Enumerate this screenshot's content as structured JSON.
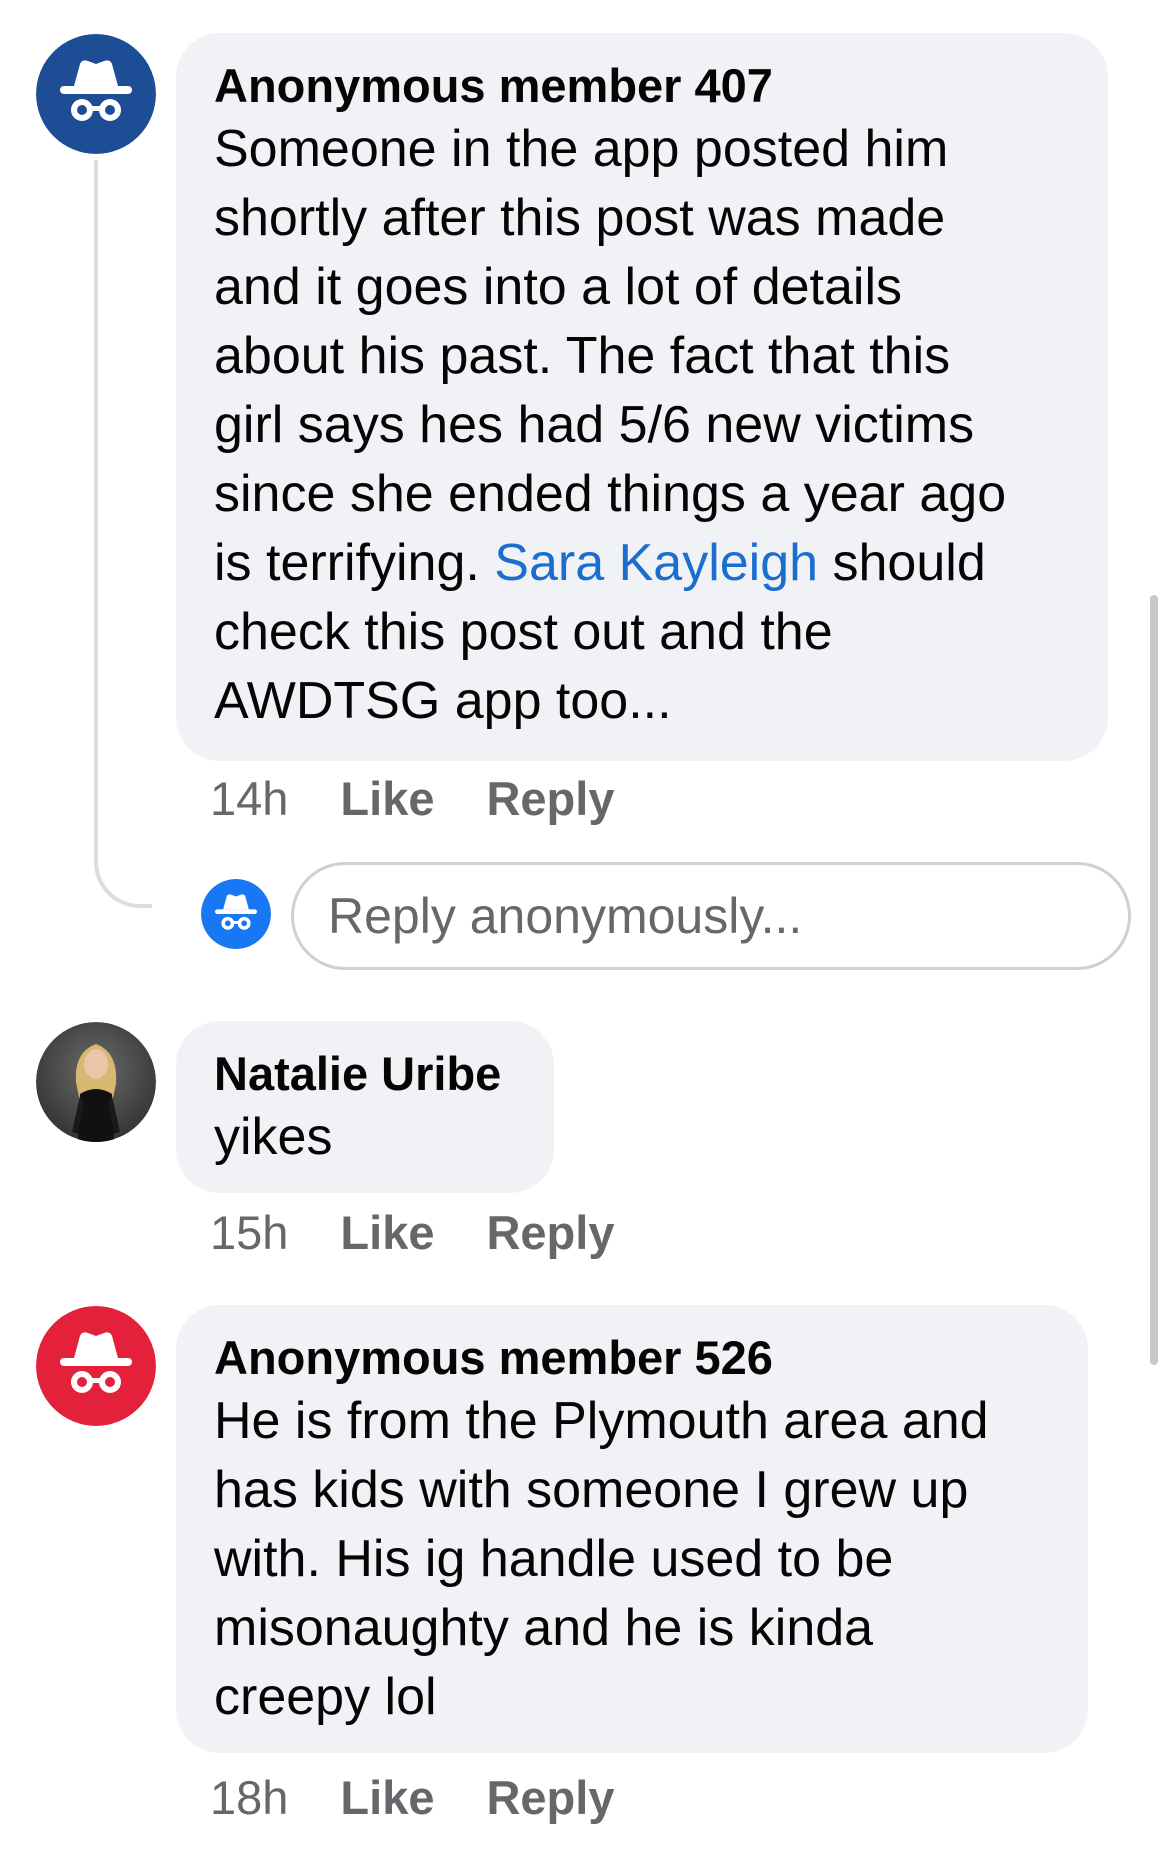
{
  "colors": {
    "bubble_bg": "#f0f2f5",
    "mention": "#1b6ed0",
    "meta_text": "#65676b",
    "anon_avatar_blue": "#1d4e95",
    "anon_avatar_bright_blue": "#1877f2",
    "anon_avatar_red": "#e3213a"
  },
  "comments": [
    {
      "avatar_icon": "incognito-icon",
      "author": "Anonymous member 407",
      "lines": [
        "Someone in the app posted him",
        "shortly after this post was made",
        "and it goes into a lot of details",
        "about his past. The fact that this",
        "girl says hes had 5/6 new victims",
        "since she ended things a year ago"
      ],
      "line_7_before": "is terrifying. ",
      "mention": "Sara Kayleigh",
      "line_7_after": " should",
      "lines_end": [
        "check this post out and the",
        "AWDTSG app too..."
      ],
      "time": "14h",
      "like": "Like",
      "reply": "Reply"
    },
    {
      "avatar_icon": "profile-photo",
      "author": "Natalie Uribe",
      "text": "yikes",
      "time": "15h",
      "like": "Like",
      "reply": "Reply"
    },
    {
      "avatar_icon": "incognito-icon",
      "author": "Anonymous member 526",
      "lines": [
        "He is from the Plymouth area and",
        "has kids with someone I grew up",
        "with. His ig handle used to be",
        "misonaughty and he is kinda",
        "creepy lol"
      ],
      "time": "18h",
      "like": "Like",
      "reply": "Reply"
    }
  ],
  "reply_input": {
    "avatar_icon": "incognito-icon",
    "placeholder": "Reply anonymously..."
  }
}
